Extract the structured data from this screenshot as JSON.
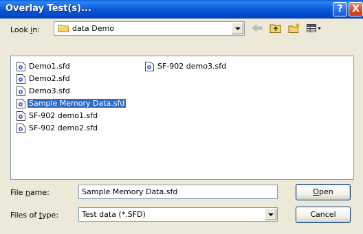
{
  "window": {
    "title": "Overlay Test(s)...",
    "help_glyph": "?",
    "close_glyph": "X"
  },
  "look_in": {
    "label_pre": "Look ",
    "label_accel": "i",
    "label_post": "n:",
    "value": "data Demo",
    "folder_icon": "folder-icon"
  },
  "toolbar": {
    "icons": [
      "back-icon",
      "up-folder-icon",
      "new-folder-icon",
      "view-menu-icon"
    ]
  },
  "files": [
    {
      "name": "Demo1.sfd",
      "selected": false
    },
    {
      "name": "Demo2.sfd",
      "selected": false
    },
    {
      "name": "Demo3.sfd",
      "selected": false
    },
    {
      "name": "Sample Memory Data.sfd",
      "selected": true
    },
    {
      "name": "SF-902 demo1.sfd",
      "selected": false
    },
    {
      "name": "SF-902 demo2.sfd",
      "selected": false
    },
    {
      "name": "SF-902 demo3.sfd",
      "selected": false
    }
  ],
  "file_name": {
    "label_pre": "File ",
    "label_accel": "n",
    "label_post": "ame:",
    "value": "Sample Memory Data.sfd"
  },
  "file_type": {
    "label_pre": "Files of ",
    "label_accel": "t",
    "label_post": "ype:",
    "value": "Test data (*.SFD)"
  },
  "buttons": {
    "open_accel": "O",
    "open_rest": "pen",
    "cancel": "Cancel"
  },
  "colors": {
    "selection": "#316ac5",
    "dialog_bg": "#ece9d8",
    "title_blue": "#0054e3"
  }
}
